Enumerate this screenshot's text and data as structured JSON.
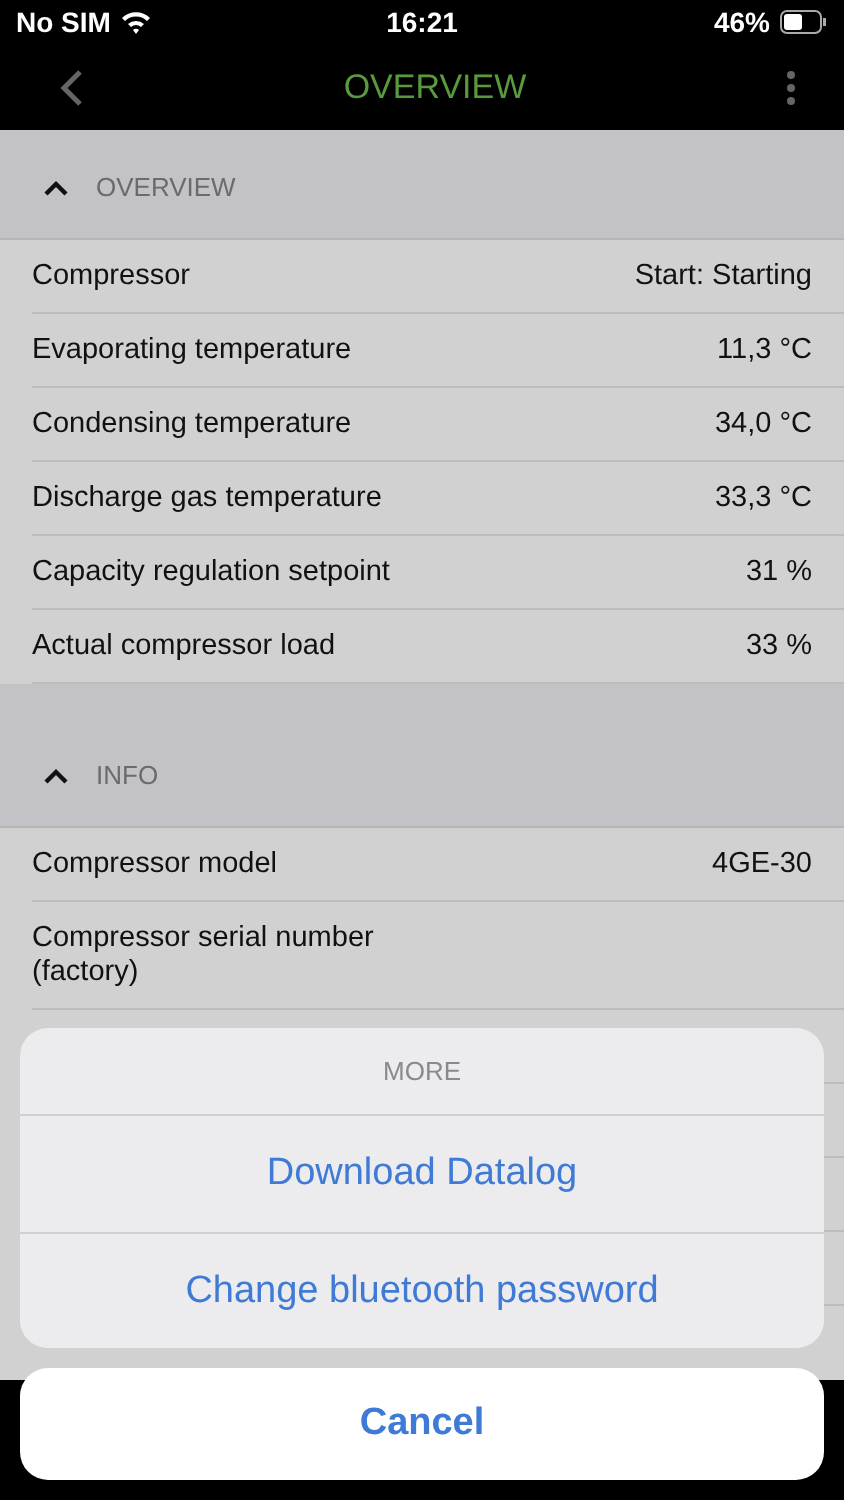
{
  "status_bar": {
    "carrier": "No SIM",
    "time": "16:21",
    "battery": "46%"
  },
  "nav_bar": {
    "title": "OVERVIEW"
  },
  "sections": [
    {
      "title": "OVERVIEW",
      "expanded": true,
      "rows": [
        {
          "label": "Compressor",
          "value": "Start: Starting"
        },
        {
          "label": "Evaporating temperature",
          "value": "11,3 °C"
        },
        {
          "label": "Condensing temperature",
          "value": "34,0 °C"
        },
        {
          "label": "Discharge gas temperature",
          "value": "33,3 °C"
        },
        {
          "label": "Capacity regulation setpoint",
          "value": "31 %"
        },
        {
          "label": "Actual compressor load",
          "value": "33 %"
        }
      ]
    },
    {
      "title": "INFO",
      "expanded": true,
      "rows": [
        {
          "label": "Compressor model",
          "value": "4GE-30"
        },
        {
          "label": "Compressor serial number (factory)"
        }
      ]
    }
  ],
  "action_sheet": {
    "title": "MORE",
    "actions": [
      "Download Datalog",
      "Change bluetooth password"
    ],
    "cancel": "Cancel"
  }
}
